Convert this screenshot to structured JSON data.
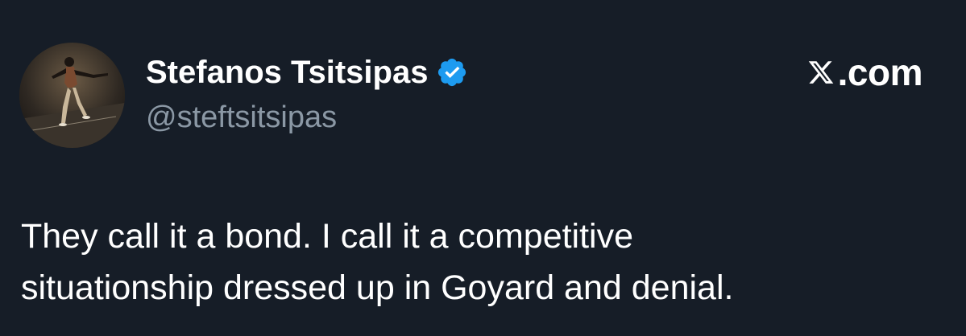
{
  "tweet": {
    "author": {
      "display_name": "Stefanos Tsitsipas",
      "handle": "@steftsitsipas",
      "verified": true,
      "avatar_icon": "player-photo-avatar"
    },
    "brand": {
      "logo_icon": "x-logo-icon",
      "suffix": ".com"
    },
    "text_lines": [
      "They call it a bond. I call it a competitive",
      "situationship dressed up in Goyard and denial."
    ]
  },
  "colors": {
    "background": "#161d27",
    "text_primary": "#ffffff",
    "text_secondary": "#8b98a5",
    "verified_badge": "#1d9bf0"
  }
}
